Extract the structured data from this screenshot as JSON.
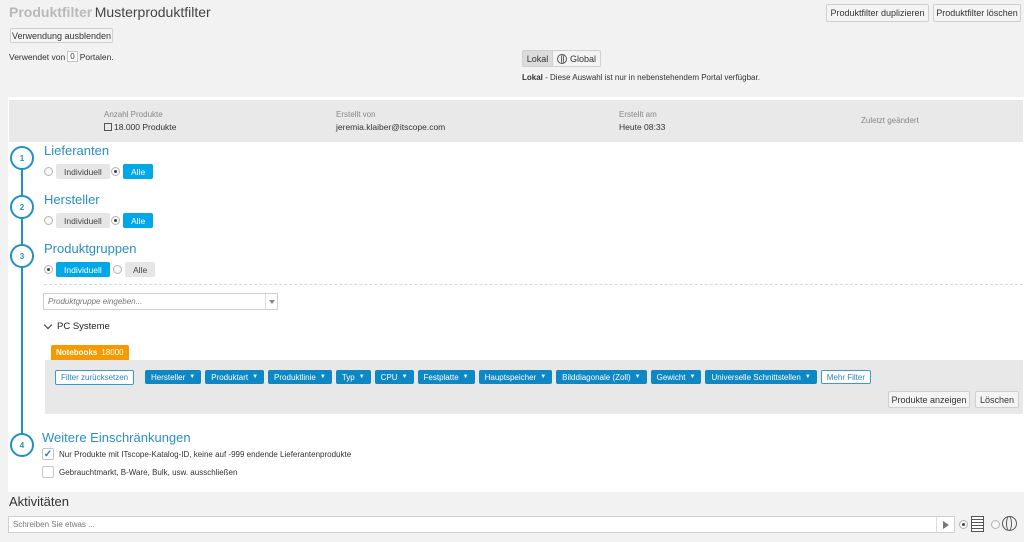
{
  "header": {
    "brand": "Produktfilter",
    "title": "Musterproduktfilter",
    "duplicate_label": "Produktfilter duplizieren",
    "delete_label": "Produktfilter löschen",
    "hide_usage_label": "Verwendung ausblenden",
    "used_prefix": "Verwendet von",
    "used_count": "0",
    "used_suffix": "Portalen."
  },
  "scope": {
    "local_label": "Lokal",
    "global_label": "Global",
    "selected": "Lokal",
    "hint_strong": "Lokal",
    "hint_rest": " - Diese Auswahl ist nur in nebenstehendem Portal verfügbar."
  },
  "stats": [
    {
      "label": "Anzahl Produkte",
      "value": "18.000 Produkte",
      "icon": "box-icon"
    },
    {
      "label": "Erstellt von",
      "value": "jeremia.klaiber@itscope.com"
    },
    {
      "label": "Erstellt am",
      "value": "Heute 08:33"
    },
    {
      "label": "Zuletzt geändert",
      "value": ""
    }
  ],
  "steps": [
    {
      "number": "1",
      "title": "Lieferanten",
      "options": [
        "Individuell",
        "Alle"
      ],
      "selected": "Alle"
    },
    {
      "number": "2",
      "title": "Hersteller",
      "options": [
        "Individuell",
        "Alle"
      ],
      "selected": "Alle"
    },
    {
      "number": "3",
      "title": "Produktgruppen",
      "options": [
        "Individuell",
        "Alle"
      ],
      "selected": "Individuell"
    },
    {
      "number": "4",
      "title": "Weitere Einschränkungen"
    }
  ],
  "productgroups": {
    "input_placeholder": "Produktgruppe eingeben...",
    "tree_label": "PC Systeme",
    "tag_label": "Notebooks",
    "tag_count": "18000",
    "reset_label": "Filter zurücksetzen",
    "filters": [
      "Hersteller",
      "Produktart",
      "Produktlinie",
      "Typ",
      "CPU",
      "Festplatte",
      "Hauptspeicher",
      "Bilddiagonale (Zoll)",
      "Gewicht",
      "Universelle Schnittstellen"
    ],
    "more_label": "Mehr Filter",
    "show_label": "Produkte anzeigen",
    "delete_label": "Löschen"
  },
  "restrictions": [
    {
      "label": "Nur Produkte mit ITscope-Katalog-ID, keine auf -999 endende Lieferantenprodukte",
      "checked": true
    },
    {
      "label": "Gebrauchtmarkt, B-Ware, Bulk, usw. ausschließen",
      "checked": false
    }
  ],
  "activities": {
    "title": "Aktivitäten",
    "placeholder": "Schreiben Sie etwas ..."
  },
  "colors": {
    "accent": "#2090c8",
    "pill_active": "#00a8e8",
    "dropdown": "#0e87c5",
    "tag": "#f59a00"
  }
}
